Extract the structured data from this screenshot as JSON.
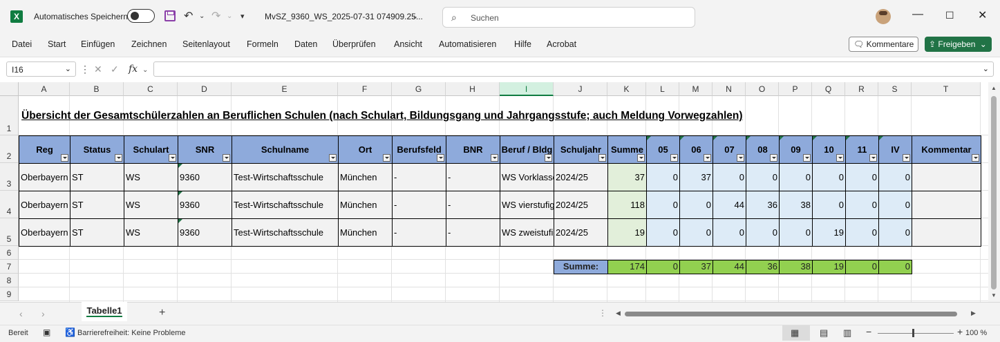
{
  "titlebar": {
    "autosave_label": "Automatisches Speichern",
    "filename": "MvSZ_9360_WS_2025-07-31 074909.25...",
    "search_placeholder": "Suchen"
  },
  "ribbon": {
    "menu": [
      "Datei",
      "Start",
      "Einfügen",
      "Zeichnen",
      "Seitenlayout",
      "Formeln",
      "Daten",
      "Überprüfen",
      "Ansicht",
      "Automatisieren",
      "Hilfe",
      "Acrobat"
    ],
    "comments_label": "Kommentare",
    "share_label": "Freigeben"
  },
  "formula": {
    "cell_ref": "I16",
    "fx": "fx",
    "content": ""
  },
  "columns": [
    "A",
    "B",
    "C",
    "D",
    "E",
    "F",
    "G",
    "H",
    "I",
    "J",
    "K",
    "L",
    "M",
    "N",
    "O",
    "P",
    "Q",
    "R",
    "S",
    "T"
  ],
  "rows": [
    "1",
    "2",
    "3",
    "4",
    "5",
    "6",
    "7",
    "8",
    "9"
  ],
  "sheet": {
    "title": "Übersicht der Gesamtschülerzahlen an Beruflichen Schulen (nach Schulart, Bildungsgang und Jahrgangsstufe; auch Meldung Vorwegzahlen)",
    "headers": [
      "Reg",
      "Status",
      "Schulart",
      "SNR",
      "Schulname",
      "Ort",
      "Berufsfeld",
      "BNR",
      "Beruf / Bldg",
      "Schuljahr",
      "Summe",
      "05",
      "06",
      "07",
      "08",
      "09",
      "10",
      "11",
      "IV",
      "Kommentar"
    ],
    "data": [
      [
        "Oberbayern",
        "ST",
        "WS",
        "9360",
        "Test-Wirtschaftsschule",
        "München",
        "-",
        "-",
        "WS Vorklasse",
        "2024/25",
        "37",
        "0",
        "37",
        "0",
        "0",
        "0",
        "0",
        "0",
        "0",
        ""
      ],
      [
        "Oberbayern",
        "ST",
        "WS",
        "9360",
        "Test-Wirtschaftsschule",
        "München",
        "-",
        "-",
        "WS vierstufig",
        "2024/25",
        "118",
        "0",
        "0",
        "44",
        "36",
        "38",
        "0",
        "0",
        "0",
        ""
      ],
      [
        "Oberbayern",
        "ST",
        "WS",
        "9360",
        "Test-Wirtschaftsschule",
        "München",
        "-",
        "-",
        "WS zweistufig",
        "2024/25",
        "19",
        "0",
        "0",
        "0",
        "0",
        "0",
        "19",
        "0",
        "0",
        ""
      ]
    ],
    "sum_label": "Summe:",
    "sums": [
      "174",
      "0",
      "37",
      "44",
      "36",
      "38",
      "19",
      "0",
      "0"
    ]
  },
  "tabs": {
    "sheet1": "Tabelle1",
    "add": "+"
  },
  "status": {
    "ready": "Bereit",
    "accessibility": "Barrierefreiheit: Keine Probleme",
    "zoom": "100 %"
  },
  "colors": {
    "excel_green": "#107c41",
    "header_blue": "#8eaadb",
    "sum_green": "#92d050"
  }
}
